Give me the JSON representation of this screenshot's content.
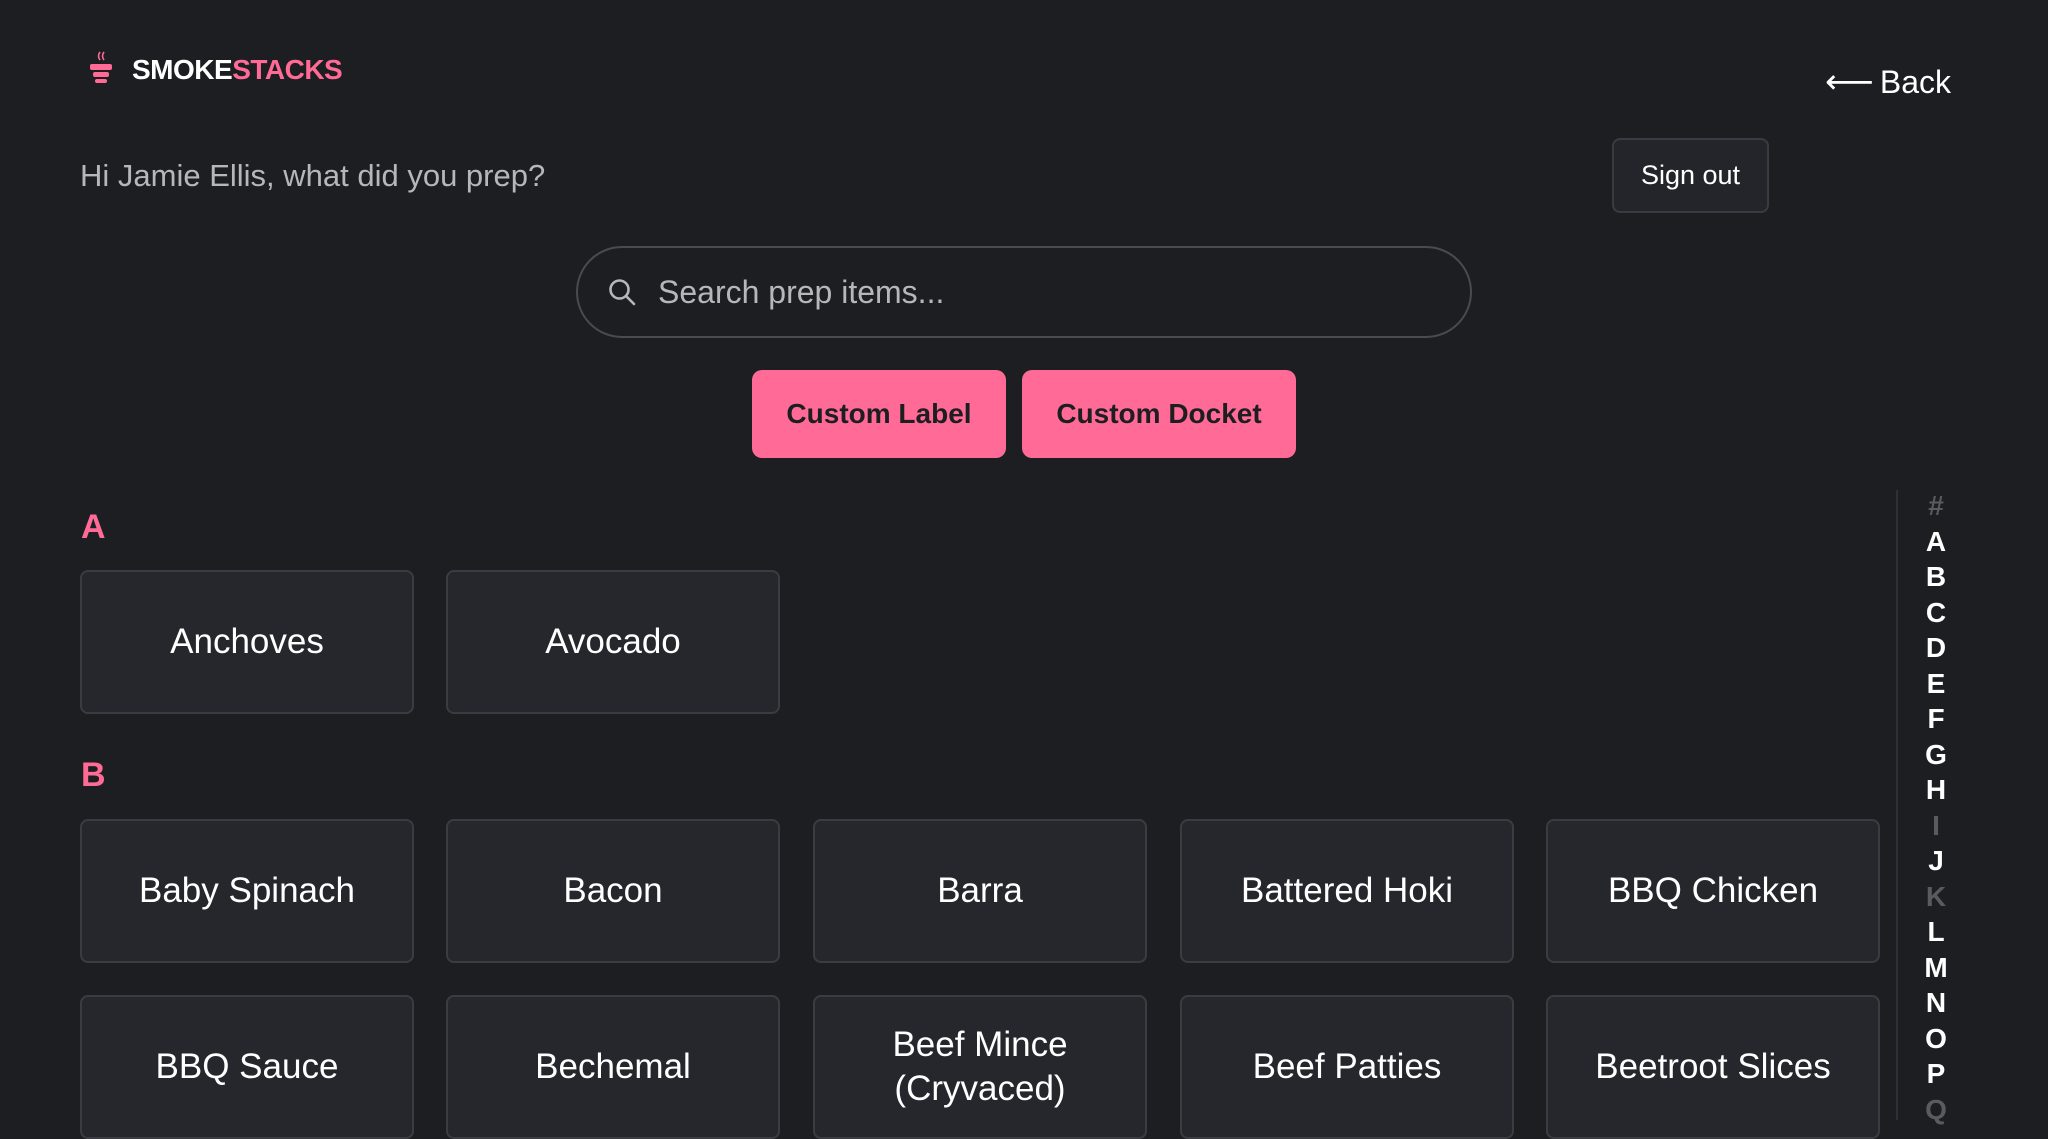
{
  "brand": {
    "name_white": "SMOKE",
    "name_pink": "STACKS",
    "icon": "smoker-icon",
    "colors": {
      "accent": "#ff6b96",
      "background": "#1d1e22",
      "card": "#26272c"
    }
  },
  "header": {
    "back_arrow": "⟵",
    "back_label": "Back",
    "greeting": "Hi Jamie Ellis, what did you prep?",
    "signout_label": "Sign out"
  },
  "search": {
    "icon": "search-icon",
    "placeholder": "Search prep items...",
    "value": ""
  },
  "actions": {
    "custom_label": "Custom Label",
    "custom_docket": "Custom Docket"
  },
  "sections": [
    {
      "letter": "A",
      "items": [
        "Anchoves",
        "Avocado"
      ]
    },
    {
      "letter": "B",
      "items": [
        "Baby Spinach",
        "Bacon",
        "Barra",
        "Battered Hoki",
        "BBQ Chicken",
        "BBQ Sauce",
        "Bechemal",
        "Beef Mince (Cryvaced)",
        "Beef Patties",
        "Beetroot Slices"
      ]
    }
  ],
  "alphabet_index": [
    {
      "letter": "#",
      "enabled": false
    },
    {
      "letter": "A",
      "enabled": true
    },
    {
      "letter": "B",
      "enabled": true
    },
    {
      "letter": "C",
      "enabled": true
    },
    {
      "letter": "D",
      "enabled": true
    },
    {
      "letter": "E",
      "enabled": true
    },
    {
      "letter": "F",
      "enabled": true
    },
    {
      "letter": "G",
      "enabled": true
    },
    {
      "letter": "H",
      "enabled": true
    },
    {
      "letter": "I",
      "enabled": false
    },
    {
      "letter": "J",
      "enabled": true
    },
    {
      "letter": "K",
      "enabled": false
    },
    {
      "letter": "L",
      "enabled": true
    },
    {
      "letter": "M",
      "enabled": true
    },
    {
      "letter": "N",
      "enabled": true
    },
    {
      "letter": "O",
      "enabled": true
    },
    {
      "letter": "P",
      "enabled": true
    },
    {
      "letter": "Q",
      "enabled": false
    }
  ]
}
